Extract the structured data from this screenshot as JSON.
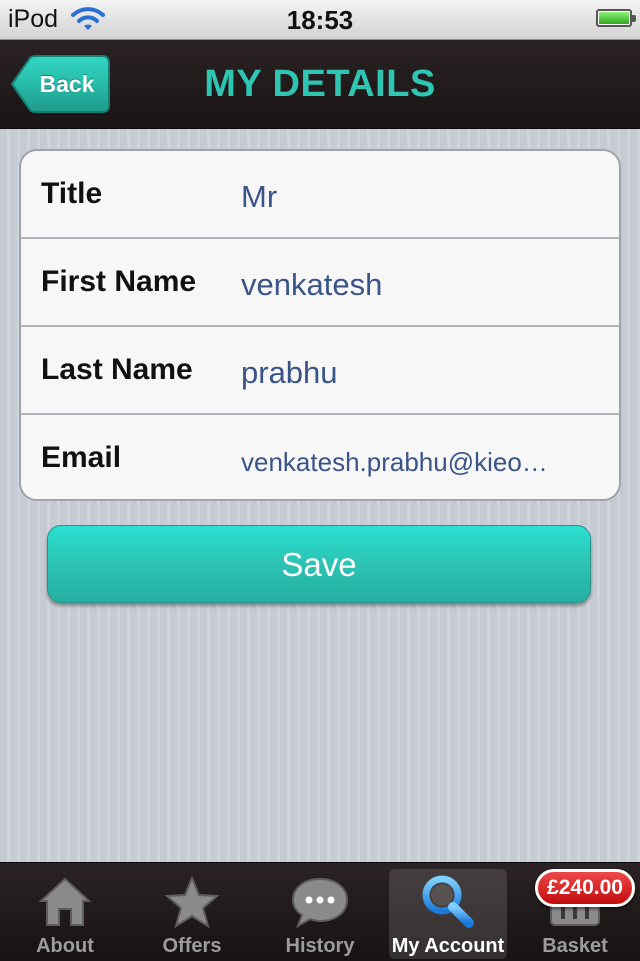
{
  "status_bar": {
    "carrier": "iPod",
    "time": "18:53",
    "icons": [
      "wifi-icon",
      "battery-icon"
    ]
  },
  "nav": {
    "back_label": "Back",
    "title": "MY DETAILS"
  },
  "form": {
    "rows": [
      {
        "label": "Title",
        "value": "Mr"
      },
      {
        "label": "First Name",
        "value": "venkatesh"
      },
      {
        "label": "Last Name",
        "value": "prabhu"
      },
      {
        "label": "Email",
        "value": "venkatesh.prabhu@kieo…"
      }
    ],
    "save_label": "Save"
  },
  "tabs": [
    {
      "label": "About",
      "icon": "house-icon",
      "selected": false
    },
    {
      "label": "Offers",
      "icon": "star-icon",
      "selected": false
    },
    {
      "label": "History",
      "icon": "chat-bubble-icon",
      "selected": false
    },
    {
      "label": "My Account",
      "icon": "magnifier-icon",
      "selected": true
    },
    {
      "label": "Basket",
      "icon": "basket-icon",
      "selected": false
    }
  ],
  "basket_badge": "£240.00",
  "colors": {
    "accent": "#2ec5b2",
    "nav_background": "#211a1b",
    "value_text": "#3b5488",
    "badge": "#d81e1e"
  }
}
